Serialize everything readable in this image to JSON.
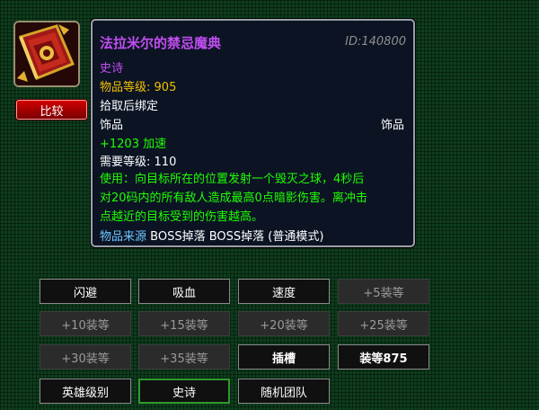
{
  "icon": {
    "name": "spellbook-icon"
  },
  "compare_button": "比较",
  "tooltip": {
    "title": "法拉米尔的禁忌魔典",
    "id": "ID:140800",
    "quality": "史诗",
    "item_level_label": "物品等级:",
    "item_level": "905",
    "bind": "拾取后绑定",
    "slot": "饰品",
    "slot_type": "饰品",
    "stat": "+1203 加速",
    "req_label": "需要等级:",
    "req_level": "110",
    "use_line1": "使用：向目标所在的位置发射一个毁灭之球，4秒后",
    "use_line2": "对20码内的所有敌人造成最高0点暗影伤害。离冲击",
    "use_line3": "点越近的目标受到的伤害越高。",
    "source_label": "物品来源",
    "source_value": "BOSS掉落 BOSS掉落 (普通模式)"
  },
  "filters": [
    {
      "label": "闪避",
      "style": "normal"
    },
    {
      "label": "吸血",
      "style": "normal"
    },
    {
      "label": "速度",
      "style": "normal"
    },
    {
      "label": "+5装等",
      "style": "dim"
    },
    {
      "label": "+10装等",
      "style": "dim"
    },
    {
      "label": "+15装等",
      "style": "dim"
    },
    {
      "label": "+20装等",
      "style": "dim"
    },
    {
      "label": "+25装等",
      "style": "dim"
    },
    {
      "label": "+30装等",
      "style": "dim"
    },
    {
      "label": "+35装等",
      "style": "dim"
    },
    {
      "label": "插槽",
      "style": "bold"
    },
    {
      "label": "装等875",
      "style": "bold"
    },
    {
      "label": "英雄级别",
      "style": "normal"
    },
    {
      "label": "史诗",
      "style": "active"
    },
    {
      "label": "随机团队",
      "style": "normal"
    }
  ]
}
